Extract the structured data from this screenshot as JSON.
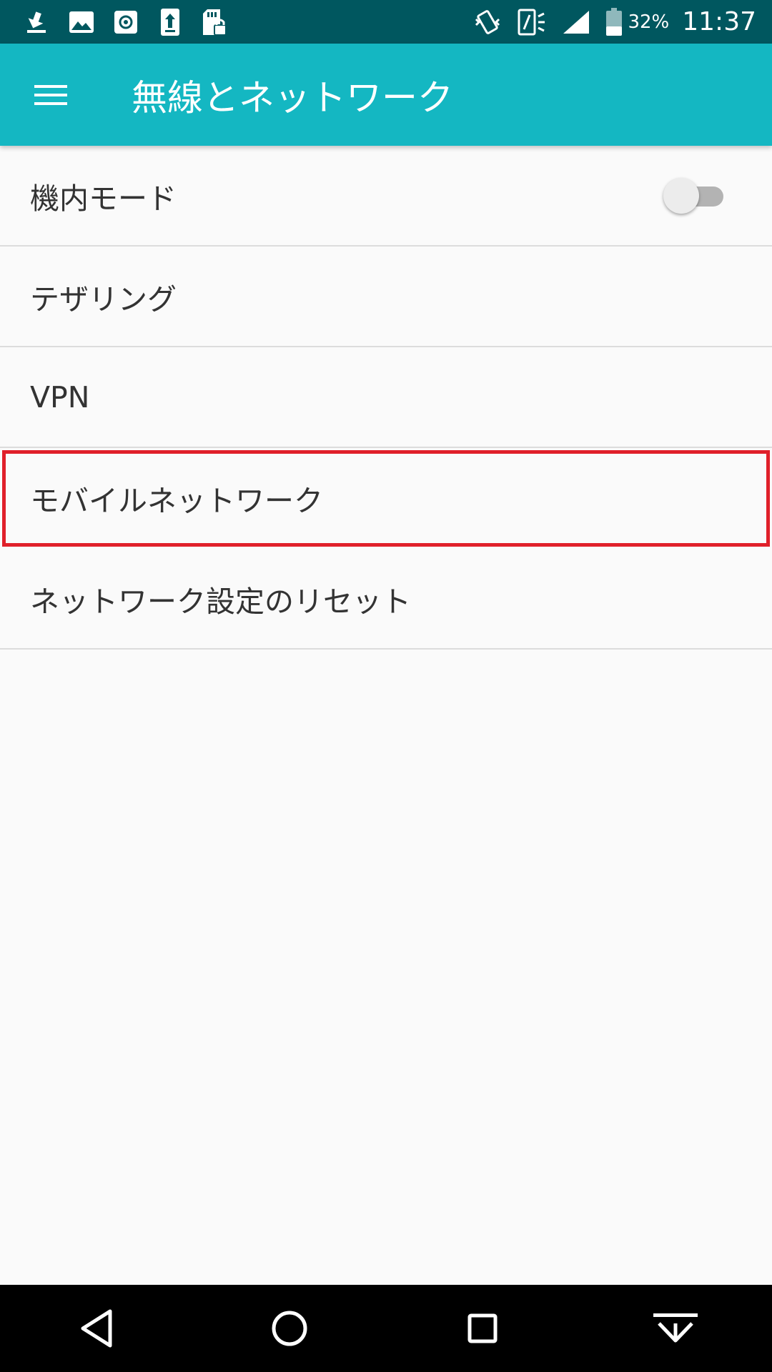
{
  "status_bar": {
    "battery_text": "32%",
    "time": "11:37",
    "left_icons": [
      "download-icon",
      "image-icon",
      "settings-icon",
      "upload-icon",
      "sd-card-lock-icon"
    ],
    "right_icons": [
      "vibrate-icon",
      "nfc-icon",
      "signal-icon",
      "battery-icon"
    ]
  },
  "app_bar": {
    "title": "無線とネットワーク",
    "menu_icon": "hamburger-menu-icon",
    "color": "#14b7c2"
  },
  "list": {
    "items": [
      {
        "label": "機内モード",
        "has_toggle": true,
        "toggle_on": false
      },
      {
        "label": "テザリング"
      },
      {
        "label": "VPN"
      },
      {
        "label": "モバイルネットワーク",
        "highlighted": true
      },
      {
        "label": "ネットワーク設定のリセット"
      }
    ]
  },
  "nav_bar": {
    "buttons": [
      "back-icon",
      "home-icon",
      "recents-icon",
      "hide-nav-icon"
    ]
  },
  "colors": {
    "status_bar": "#00575f",
    "app_bar": "#14b7c2",
    "highlight": "#e0202a"
  }
}
